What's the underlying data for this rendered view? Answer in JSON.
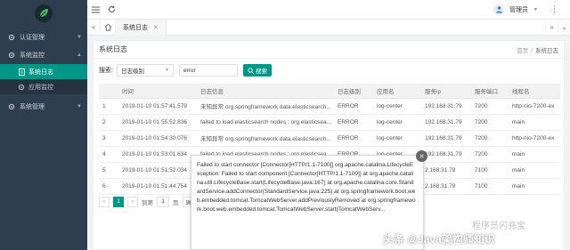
{
  "sidebar": {
    "logo_icon": "leaf-logo",
    "items": [
      {
        "label": "认证管理",
        "icon": "gear-icon",
        "expanded": false
      },
      {
        "label": "系统监控",
        "icon": "gear-icon",
        "expanded": true,
        "children": [
          {
            "label": "系统日志",
            "icon": "file-icon",
            "active": true
          },
          {
            "label": "应用监控",
            "icon": "gear-icon",
            "active": false
          }
        ]
      },
      {
        "label": "系统管理",
        "icon": "gear-icon",
        "expanded": false
      }
    ]
  },
  "topbar": {
    "user_name": "管理员"
  },
  "tabs": [
    {
      "label": "系统日志"
    }
  ],
  "page": {
    "title": "系统日志",
    "breadcrumb": [
      "首页",
      "系统日志"
    ]
  },
  "search": {
    "label": "搜索:",
    "select_value": "日志级别",
    "input_value": "error",
    "button_label": "搜索"
  },
  "table": {
    "columns": [
      "",
      "时间",
      "日志信息",
      "日志级别",
      "应用名",
      "服务ip",
      "服务端口",
      "线程名"
    ],
    "rows": [
      [
        "1",
        "2019-01-10 01:57:41.579",
        "未知异常 org.springframework.data.elasticsearch...",
        "ERROR",
        "log-center",
        "192.168.31.79",
        "7200",
        "http-nio-7200-ex"
      ],
      [
        "2",
        "2019-01-10 01:55:52.836",
        "failed to load elasticsearch nodes : org.elasticsea...",
        "ERROR",
        "log-center",
        "192.168.31.79",
        "7200",
        "main"
      ],
      [
        "3",
        "2019-01-10 01:54:30.076",
        "未知异常 org.springframework.data.elasticsearch...",
        "ERROR",
        "log-center",
        "192.168.31.79",
        "7200",
        "http-nio-7200-ex"
      ],
      [
        "4",
        "2019-01-10 01:53:01.634",
        "failed to load elasticsearch nodes : org.elasticsea...",
        "ERROR",
        "log-center",
        "192.168.31.79",
        "7200",
        "main"
      ],
      [
        "5",
        "2019-01-10 01:51:52.034",
        "",
        "",
        "",
        "2.168.31.79",
        "7100",
        "main"
      ],
      [
        "6",
        "2019-01-10 01:51:44.754",
        "",
        "",
        "",
        "2.168.31.79",
        "7100",
        "main"
      ]
    ]
  },
  "pager": {
    "current": "1",
    "goto_label": "到第",
    "goto_value": "1",
    "page_unit": "页",
    "confirm_label": "确"
  },
  "tooltip": {
    "text": "Failed to start connector [Connector[HTTP/1.1-7100]] org.apache.catalina.LifecycleException: Failed to start component [Connector[HTTP/1.1-7100]] at org.apache.catalina.util.LifecycleBase.start(LifecycleBase.java:167) at org.apache.catalina.core.StandardService.addConnector(StandardService.java:225) at org.springframework.boot.web.embedded.tomcat.TomcatWebServer.addPreviouslyRemoved at org.springframework.boot.web.embedded.tomcat.TomcatWebServer.start(TomcatWebServ..."
  },
  "watermark": {
    "line1": "程序员闪充宝",
    "line2": "头条 @Java架构师知识"
  },
  "colors": {
    "accent": "#009688",
    "sidebar_bg": "#2f3e4e"
  }
}
